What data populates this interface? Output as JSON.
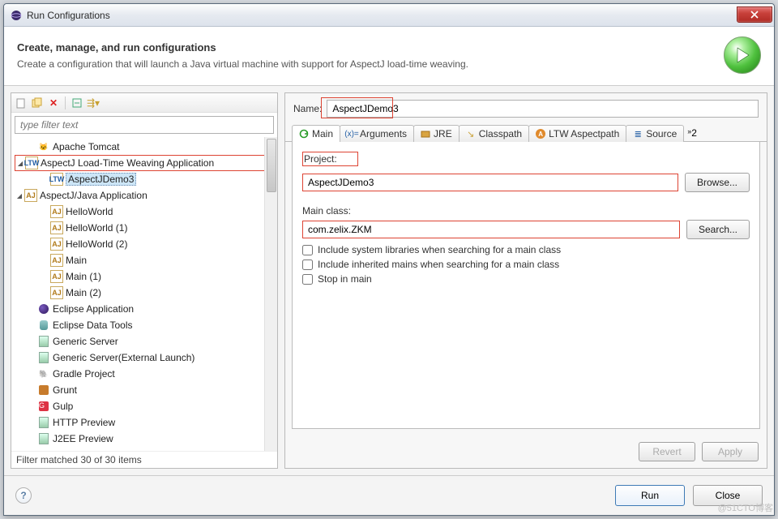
{
  "window": {
    "title": "Run Configurations"
  },
  "header": {
    "title": "Create, manage, and run configurations",
    "subtitle": "Create a configuration that will launch a Java virtual machine with support for AspectJ load-time weaving."
  },
  "left": {
    "filter_placeholder": "type filter text",
    "filter_status": "Filter matched 30 of 30 items",
    "tree": [
      {
        "label": "Apache Tomcat",
        "icon": "tomcat",
        "indent": 1
      },
      {
        "label": "AspectJ Load-Time Weaving Application",
        "icon": "ltw",
        "indent": 0,
        "expanded": true,
        "highlighted": true
      },
      {
        "label": "AspectJDemo3",
        "icon": "ltw",
        "indent": 2,
        "selected": true
      },
      {
        "label": "AspectJ/Java Application",
        "icon": "aj",
        "indent": 0,
        "expanded": true
      },
      {
        "label": "HelloWorld",
        "icon": "aj",
        "indent": 2
      },
      {
        "label": "HelloWorld (1)",
        "icon": "aj",
        "indent": 2
      },
      {
        "label": "HelloWorld (2)",
        "icon": "aj",
        "indent": 2
      },
      {
        "label": "Main",
        "icon": "aj",
        "indent": 2
      },
      {
        "label": "Main (1)",
        "icon": "aj",
        "indent": 2
      },
      {
        "label": "Main (2)",
        "icon": "aj",
        "indent": 2
      },
      {
        "label": "Eclipse Application",
        "icon": "eclipse",
        "indent": 1
      },
      {
        "label": "Eclipse Data Tools",
        "icon": "db",
        "indent": 1
      },
      {
        "label": "Generic Server",
        "icon": "server",
        "indent": 1
      },
      {
        "label": "Generic Server(External Launch)",
        "icon": "server",
        "indent": 1
      },
      {
        "label": "Gradle Project",
        "icon": "gradle",
        "indent": 1
      },
      {
        "label": "Grunt",
        "icon": "grunt",
        "indent": 1
      },
      {
        "label": "Gulp",
        "icon": "gulp",
        "indent": 1
      },
      {
        "label": "HTTP Preview",
        "icon": "server",
        "indent": 1
      },
      {
        "label": "J2EE Preview",
        "icon": "server",
        "indent": 1
      }
    ]
  },
  "form": {
    "name_label": "Name:",
    "name_value": "AspectJDemo3",
    "project_label": "Project:",
    "project_value": "AspectJDemo3",
    "browse": "Browse...",
    "mainclass_label": "Main class:",
    "mainclass_value": "com.zelix.ZKM",
    "search": "Search...",
    "check1": "Include system libraries when searching for a main class",
    "check2": "Include inherited mains when searching for a main class",
    "check3": "Stop in main",
    "revert": "Revert",
    "apply": "Apply"
  },
  "tabs": [
    {
      "label": "Main",
      "icon": "refresh",
      "active": true
    },
    {
      "label": "Arguments",
      "icon": "args"
    },
    {
      "label": "JRE",
      "icon": "jre"
    },
    {
      "label": "Classpath",
      "icon": "classpath"
    },
    {
      "label": "LTW Aspectpath",
      "icon": "ltw-tab"
    },
    {
      "label": "Source",
      "icon": "source"
    }
  ],
  "tabs_more": "2",
  "footer": {
    "run": "Run",
    "close": "Close"
  },
  "watermark": "@51CTO博客"
}
